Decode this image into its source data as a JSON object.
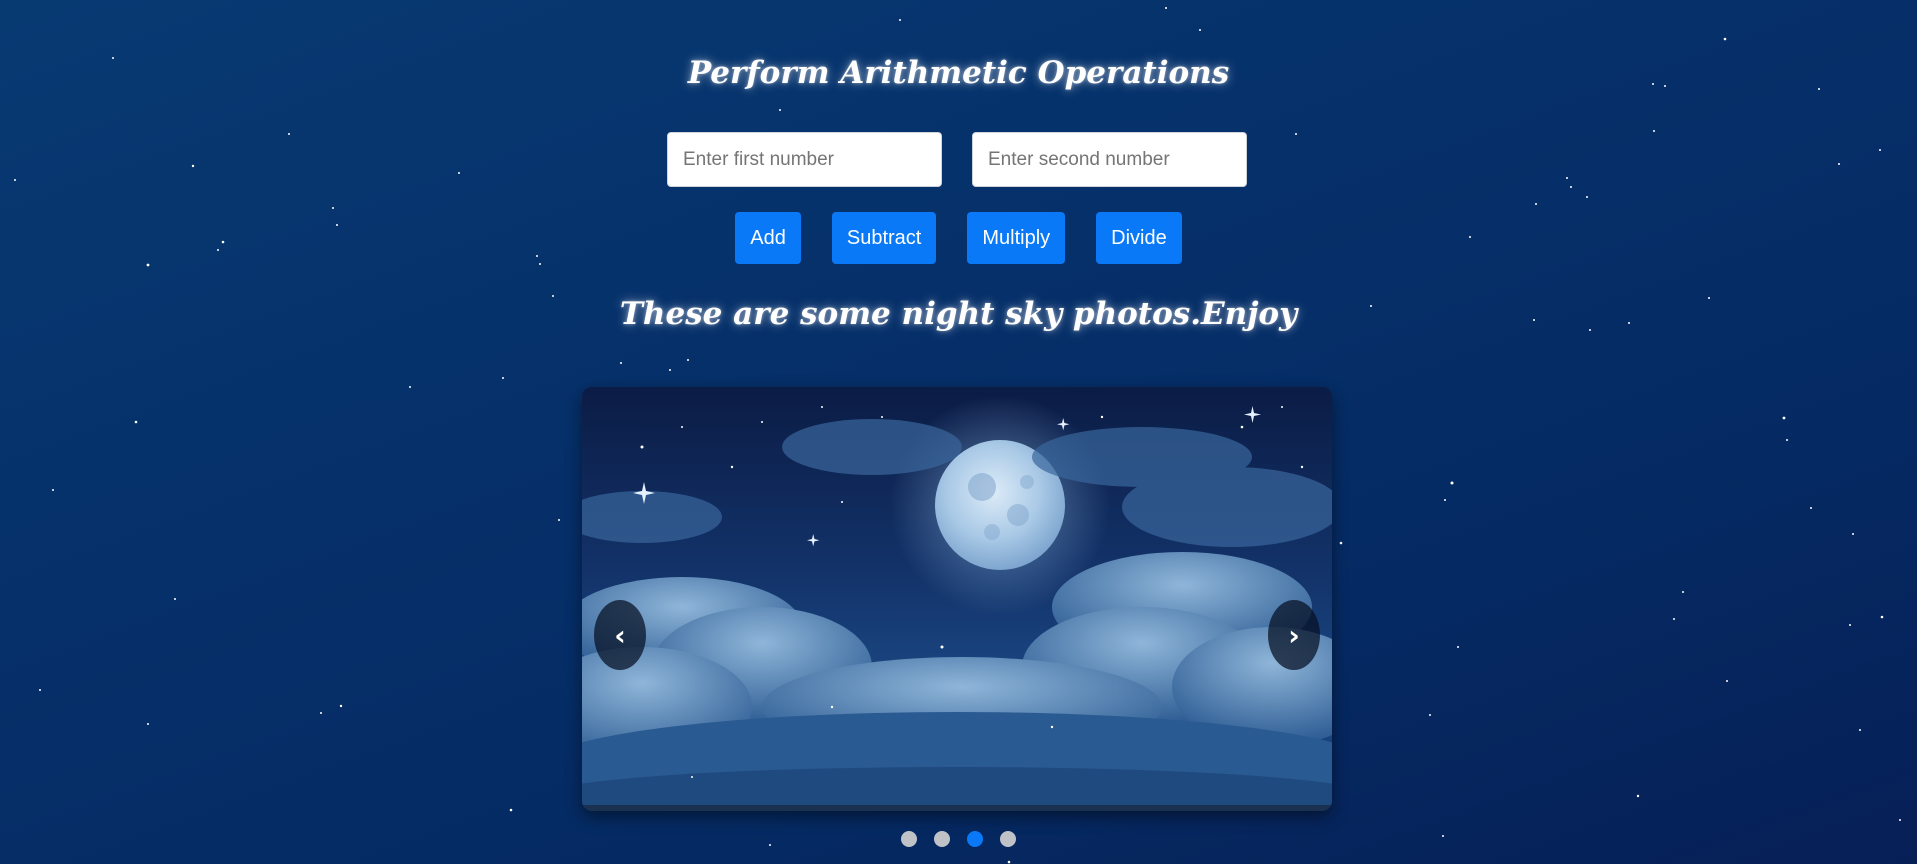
{
  "page": {
    "heading": "Perform Arithmetic Operations",
    "gallery_heading": "These are some night sky photos.Enjoy"
  },
  "calculator": {
    "first_placeholder": "Enter first number",
    "second_placeholder": "Enter second number",
    "first_value": "",
    "second_value": "",
    "buttons": {
      "add": "Add",
      "subtract": "Subtract",
      "multiply": "Multiply",
      "divide": "Divide"
    }
  },
  "carousel": {
    "prev_icon": "‹",
    "next_icon": "›",
    "slide_count": 4,
    "active_index": 2
  },
  "colors": {
    "accent": "#0a79f7",
    "background": "#06306a",
    "dot_inactive": "#bfc3c8"
  }
}
